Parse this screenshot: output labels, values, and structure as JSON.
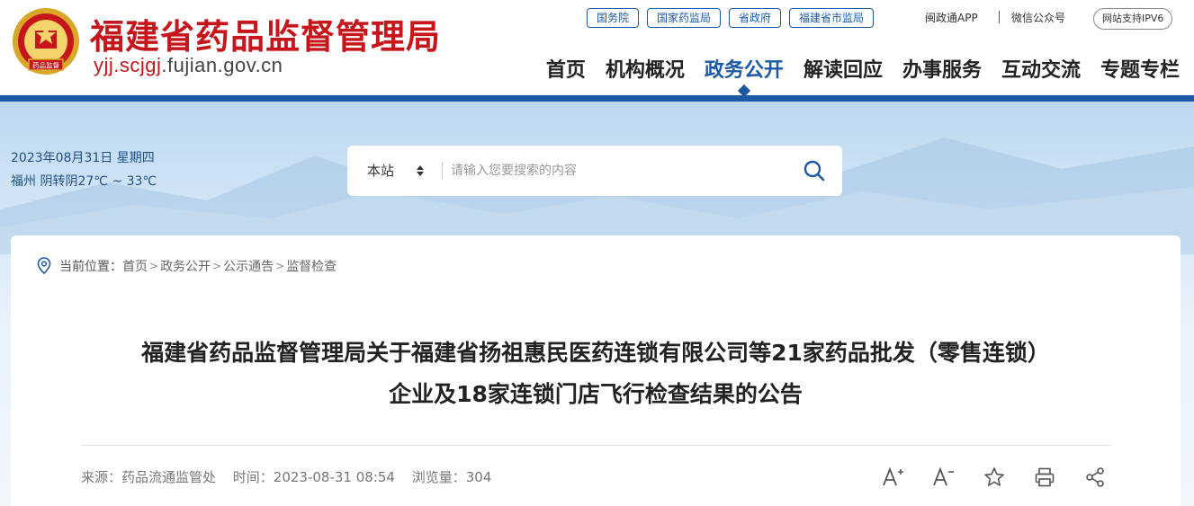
{
  "header": {
    "title": "福建省药品监督管理局",
    "domain_red": "yjj.scjgj",
    "domain_rest": ".fujian.gov.cn",
    "emblem_text": "药品监督",
    "brand_color": "#c6151b",
    "accent_color": "#1d58a6"
  },
  "top_links": {
    "pills": [
      "国务院",
      "国家药监局",
      "省政府",
      "福建省市监局"
    ],
    "app": "闽政通APP",
    "wechat": "微信公众号",
    "ipv6": "网站支持IPV6"
  },
  "nav": {
    "items": [
      "首页",
      "机构概况",
      "政务公开",
      "解读回应",
      "办事服务",
      "互动交流",
      "专题专栏"
    ],
    "active": "政务公开"
  },
  "banner": {
    "date": "2023年08月31日 星期四",
    "weather": "福州 阴转阴27℃ ~ 33℃"
  },
  "search": {
    "scope": "本站",
    "placeholder": "请输入您要搜索的内容",
    "icon": "search-icon"
  },
  "breadcrumb": {
    "label": "当前位置：",
    "items": [
      "首页",
      "政务公开",
      "公示通告",
      "监督检查"
    ],
    "separator": ">"
  },
  "article": {
    "title_line1": "福建省药品监督管理局关于福建省扬祖惠民医药连锁有限公司等21家药品批发（零售连锁）",
    "title_line2": "企业及18家连锁门店飞行检查结果的公告",
    "source": "来源：药品流通监管处",
    "time": "时间：2023-08-31 08:54",
    "views": "浏览量：304"
  },
  "tools": [
    "font-increase-icon",
    "font-decrease-icon",
    "star-icon",
    "print-icon",
    "share-icon"
  ]
}
